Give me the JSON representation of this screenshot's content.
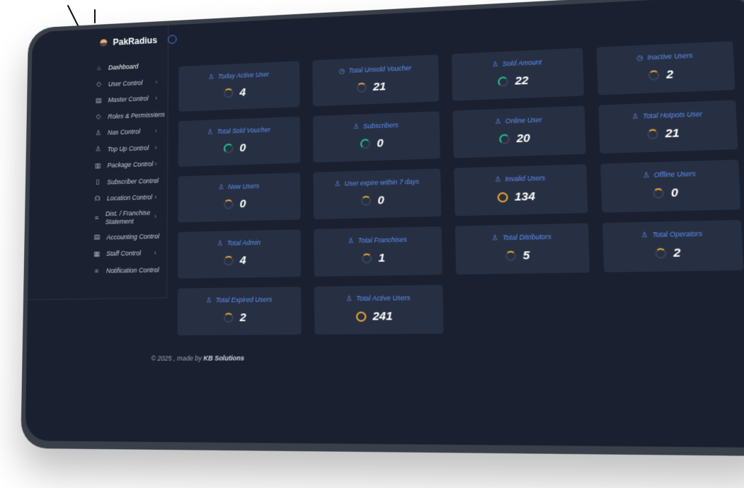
{
  "brand": {
    "name": "PakRadius"
  },
  "sidebar": {
    "items": [
      {
        "label": "Dashboard",
        "icon": "home-icon",
        "glyph": "⌂",
        "chevron": false
      },
      {
        "label": "User Control",
        "icon": "shield-icon",
        "glyph": "◇",
        "chevron": true
      },
      {
        "label": "Master Control",
        "icon": "grid-icon",
        "glyph": "▤",
        "chevron": true
      },
      {
        "label": "Roles & Permissions",
        "icon": "shield-icon",
        "glyph": "◇",
        "chevron": true
      },
      {
        "label": "Nas Control",
        "icon": "user-icon",
        "glyph": "♙",
        "chevron": true
      },
      {
        "label": "Top Up Control",
        "icon": "user-icon",
        "glyph": "♙",
        "chevron": true
      },
      {
        "label": "Package Control",
        "icon": "book-icon",
        "glyph": "▥",
        "chevron": true
      },
      {
        "label": "Subscriber Control",
        "icon": "document-icon",
        "glyph": "▯",
        "chevron": true
      },
      {
        "label": "Location Control",
        "icon": "headset-icon",
        "glyph": "☊",
        "chevron": true
      },
      {
        "label": "Dist. / Franchise Statement",
        "icon": "list-icon",
        "glyph": "≡",
        "chevron": true
      },
      {
        "label": "Accounting Control",
        "icon": "ledger-icon",
        "glyph": "▤",
        "chevron": true
      },
      {
        "label": "Staff Control",
        "icon": "staff-icon",
        "glyph": "▦",
        "chevron": true
      },
      {
        "label": "Notification Control",
        "icon": "list-icon",
        "glyph": "≡",
        "chevron": true
      }
    ]
  },
  "cards": [
    {
      "title": "Today Active User",
      "value": "4",
      "icon": "user-icon",
      "ring": "orange"
    },
    {
      "title": "Total Unsold Voucher",
      "value": "21",
      "icon": "clock-icon",
      "ring": "orange"
    },
    {
      "title": "Sold Amount",
      "value": "22",
      "icon": "user-icon",
      "ring": "green"
    },
    {
      "title": "Inactive Users",
      "value": "2",
      "icon": "clock-icon",
      "ring": "orange"
    },
    {
      "title": "Total Sold Voucher",
      "value": "0",
      "icon": "user-icon",
      "ring": "green"
    },
    {
      "title": "Subscribers",
      "value": "0",
      "icon": "user-icon",
      "ring": "green"
    },
    {
      "title": "Online User",
      "value": "20",
      "icon": "user-icon",
      "ring": "green"
    },
    {
      "title": "Total Hotpots User",
      "value": "21",
      "icon": "user-icon",
      "ring": "orange"
    },
    {
      "title": "New Users",
      "value": "0",
      "icon": "user-icon",
      "ring": "orange"
    },
    {
      "title": "User expire within 7 days",
      "value": "0",
      "icon": "user-icon",
      "ring": "orange"
    },
    {
      "title": "Invalid Users",
      "value": "134",
      "icon": "user-icon",
      "ring": "orange-full"
    },
    {
      "title": "Offline Users",
      "value": "0",
      "icon": "user-icon",
      "ring": "orange"
    },
    {
      "title": "Total Admin",
      "value": "4",
      "icon": "user-icon",
      "ring": "orange"
    },
    {
      "title": "Total Franchises",
      "value": "1",
      "icon": "user-icon",
      "ring": "orange"
    },
    {
      "title": "Total Ditributors",
      "value": "5",
      "icon": "user-icon",
      "ring": "orange"
    },
    {
      "title": "Total Operators",
      "value": "2",
      "icon": "user-icon",
      "ring": "orange"
    },
    {
      "title": "Total Expired Users",
      "value": "2",
      "icon": "user-icon",
      "ring": "orange"
    },
    {
      "title": "Total Active Users",
      "value": "241",
      "icon": "user-icon",
      "ring": "orange-full"
    }
  ],
  "footer": {
    "prefix": "© 2025 , made by ",
    "company": "KB Solutions"
  },
  "colors": {
    "accent": "#5d8ff0",
    "background": "#1a2030",
    "card": "#273043",
    "ring_orange": "#e8a432",
    "ring_green": "#22c08a"
  }
}
